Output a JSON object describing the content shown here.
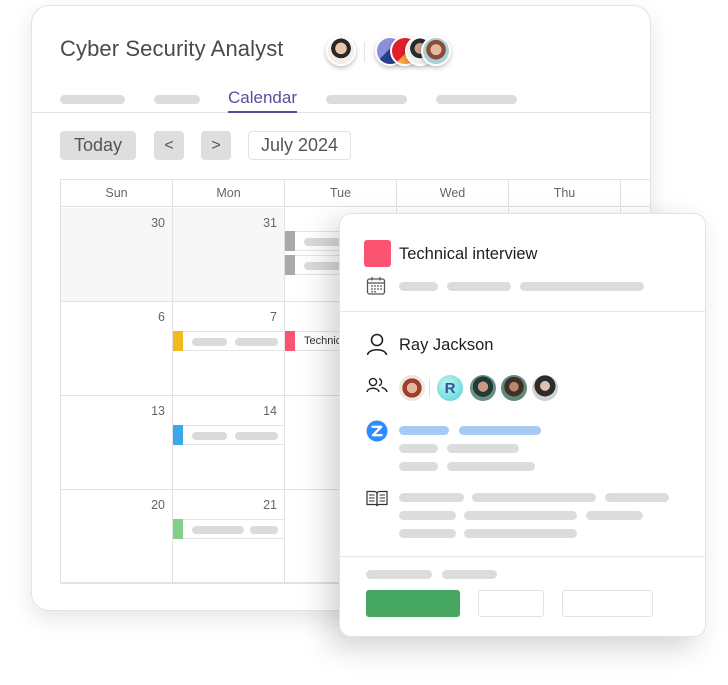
{
  "header": {
    "title": "Cyber Security Analyst",
    "owner_avatar": "owner-avatar",
    "team_avatars": [
      "team-avatar-1",
      "team-avatar-2",
      "team-avatar-3",
      "team-avatar-4"
    ]
  },
  "tabs": {
    "active_label": "Calendar",
    "placeholder_count": 4
  },
  "toolbar": {
    "today_label": "Today",
    "prev_label": "<",
    "next_label": ">",
    "month_label": "July 2024"
  },
  "calendar": {
    "weekdays": [
      "Sun",
      "Mon",
      "Tue",
      "Wed",
      "Thu"
    ],
    "weeks": [
      {
        "days": [
          "30",
          "31",
          "",
          "",
          ""
        ],
        "past": true
      },
      {
        "days": [
          "6",
          "7",
          "",
          "",
          ""
        ],
        "past": false
      },
      {
        "days": [
          "13",
          "14",
          "",
          "",
          ""
        ],
        "past": false
      },
      {
        "days": [
          "20",
          "21",
          "",
          "",
          ""
        ],
        "past": false
      }
    ],
    "events": [
      {
        "week": 0,
        "day": 2,
        "color": "#a9a9a9",
        "label": ""
      },
      {
        "week": 0,
        "day": 2,
        "color": "#a9a9a9",
        "label": ""
      },
      {
        "week": 1,
        "day": 1,
        "color": "#f2b91f",
        "label": ""
      },
      {
        "week": 1,
        "day": 2,
        "color": "#fb5372",
        "label": "Technic"
      },
      {
        "week": 2,
        "day": 1,
        "color": "#3aa9ea",
        "label": ""
      },
      {
        "week": 3,
        "day": 1,
        "color": "#82cf8a",
        "label": ""
      }
    ]
  },
  "detail": {
    "event_title": "Technical interview",
    "event_color": "#fb5372",
    "organizer": "Ray Jackson",
    "attendee_initial": "R",
    "icons": {
      "date": "calendar-icon",
      "organizer": "person-icon",
      "attendees": "people-icon",
      "meeting": "zoom-icon",
      "notes": "book-icon"
    }
  },
  "colors": {
    "accent": "#5b4d9d",
    "primary_button": "#44a660",
    "zoom_blue": "#2d8cff",
    "link_placeholder": "#a6cbf3"
  }
}
